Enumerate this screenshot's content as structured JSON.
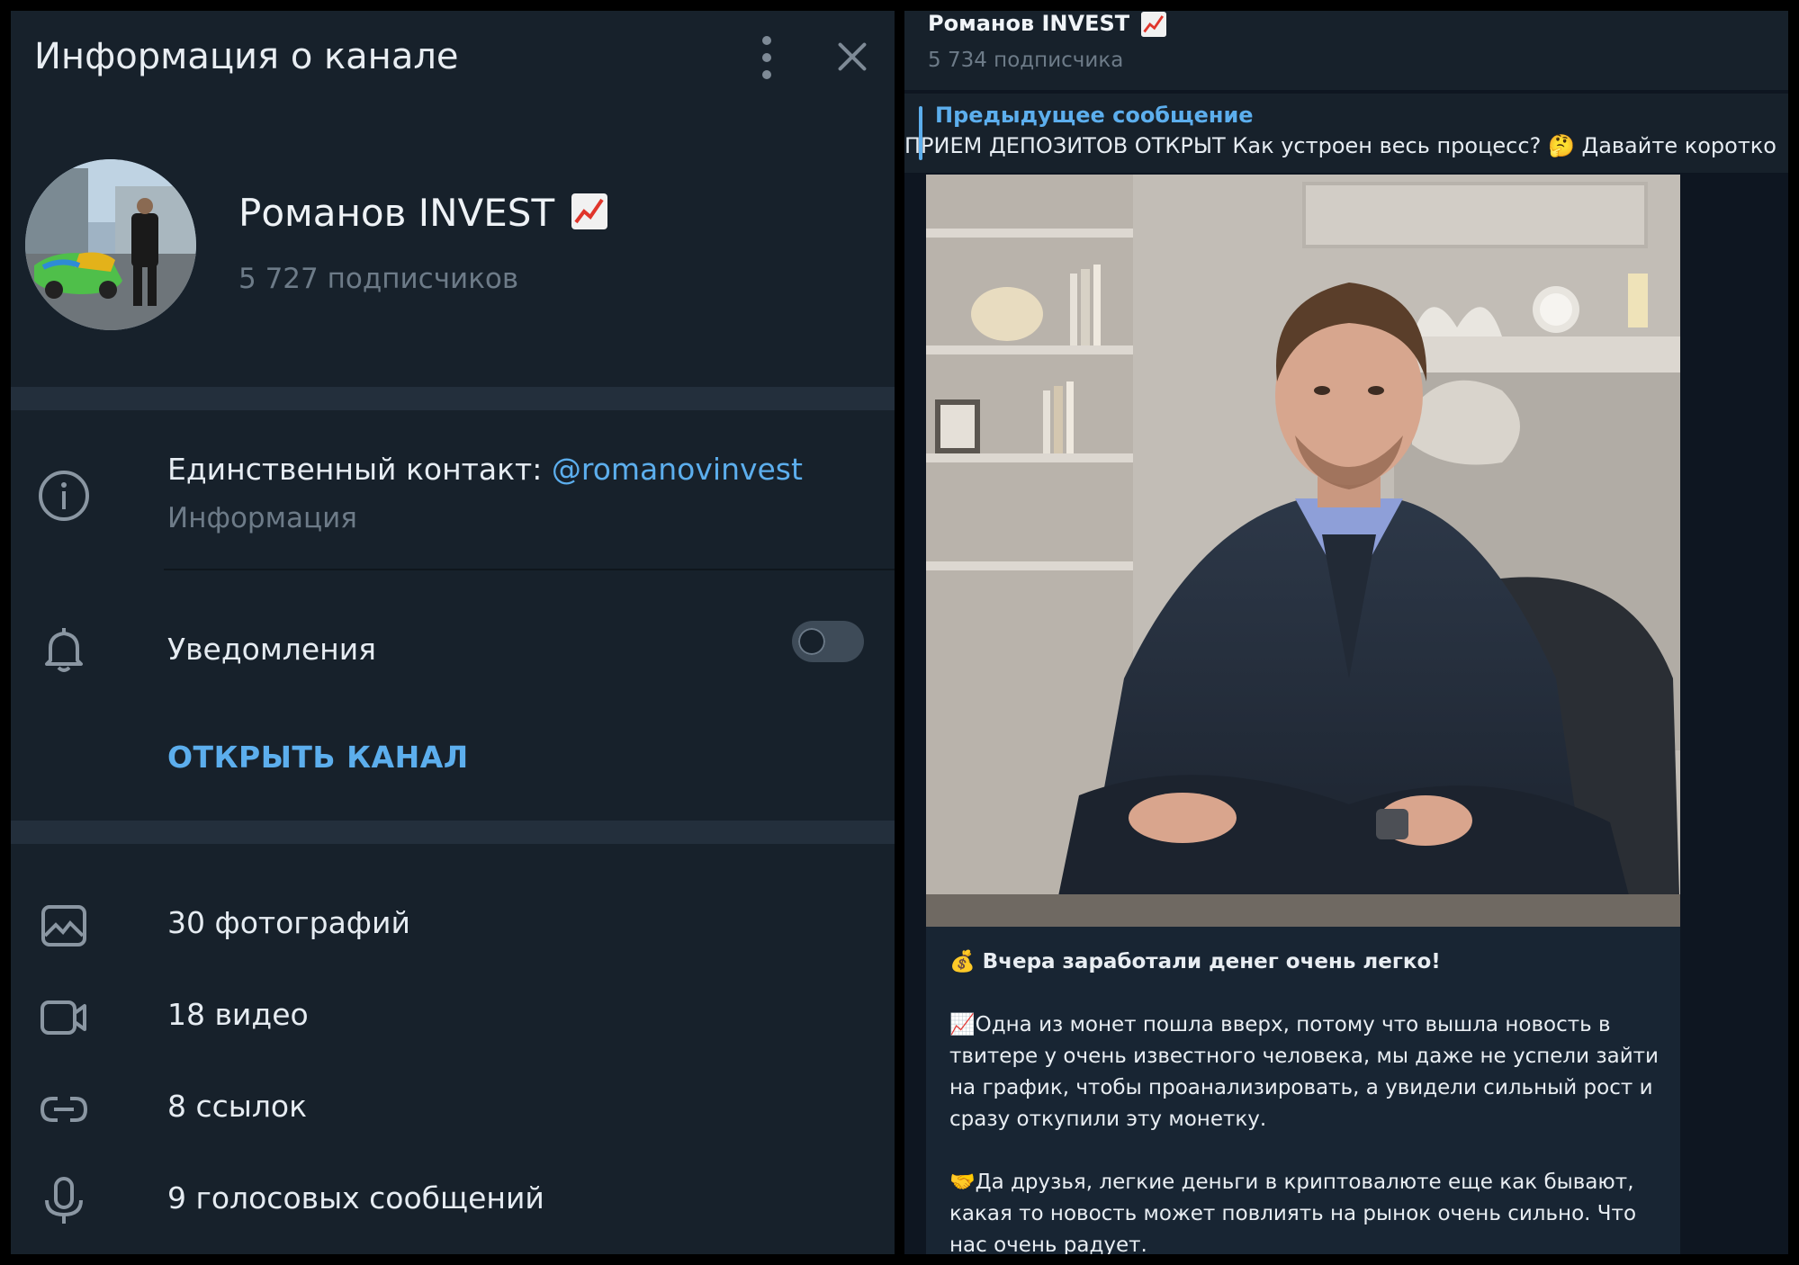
{
  "left_panel": {
    "title": "Информация о канале",
    "channel": {
      "name": "Романов INVEST",
      "subscribers": "5 727 подписчиков"
    },
    "info": {
      "contact_prefix": "Единственный контакт: ",
      "contact_handle": "@romanovinvest",
      "label": "Информация"
    },
    "notifications": {
      "label": "Уведомления",
      "enabled": false
    },
    "open_channel_label": "ОТКРЫТЬ КАНАЛ",
    "media": {
      "photos": "30 фотографий",
      "videos": "18 видео",
      "links": "8 ссылок",
      "voice": "9 голосовых сообщений"
    }
  },
  "right_panel": {
    "channel_name": "Романов INVEST",
    "subscribers": "5 734 подписчика",
    "pinned": {
      "title": "Предыдущее сообщение",
      "text": "ПРИЕМ ДЕПОЗИТОВ ОТКРЫТ  Как устроен весь процесс? 🤔  Давайте коротко"
    },
    "message": {
      "line1": "💰 Вчера заработали денег очень легко!",
      "para2": "📈Одна из монет пошла вверх, потому что вышла новость в твитере у очень известного человека, мы даже не успели зайти на график, чтобы проанализировать, а увидели сильный рост и сразу откупили эту монетку.",
      "para3": "🤝Да друзья, легкие деньги в криптовалюте еще как бывают, какая то новость может повлиять на рынок очень сильно. Что нас очень радует."
    }
  },
  "colors": {
    "panel_bg": "#17212b",
    "chat_bg": "#0e1621",
    "accent": "#5caeed",
    "muted": "#6d7b88"
  }
}
